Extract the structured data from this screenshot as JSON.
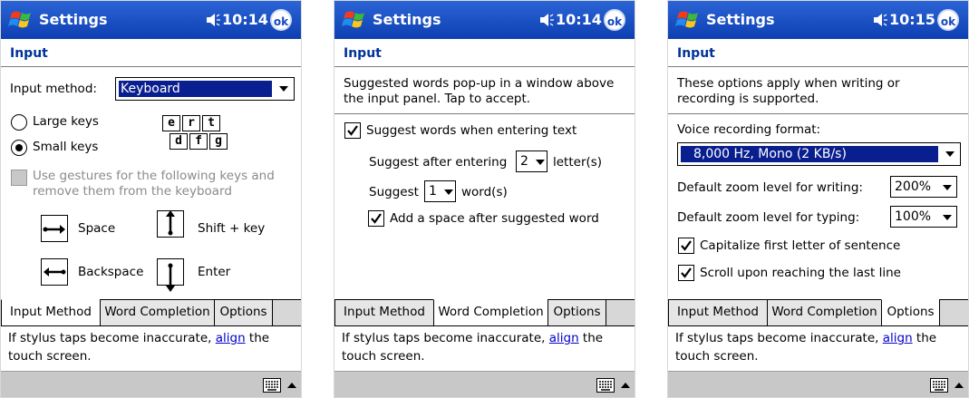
{
  "colors": {
    "titlebar": "#0d3fb2",
    "heading": "#003399",
    "selection": "#0a1f8f",
    "link": "#0000cc",
    "menubar": "#c8c8c8"
  },
  "icons": {
    "start": "windows-flag-icon",
    "volume": "speaker-icon",
    "ok": "ok-button-icon",
    "keyboard": "keyboard-icon",
    "sip": "triangle-up-icon"
  },
  "screens": [
    {
      "title": "Settings",
      "time": "10:14",
      "ok": "ok",
      "heading": "Input",
      "input_method_label": "Input method:",
      "input_method_value": "Keyboard",
      "radio_large": "Large keys",
      "radio_small": "Small keys",
      "keys_top": [
        "e",
        "r",
        "t"
      ],
      "keys_bottom": [
        "d",
        "f",
        "g"
      ],
      "gestures_checkbox": "Use gestures for the following keys and remove them from the keyboard",
      "gesture_space": "Space",
      "gesture_shift": "Shift + key",
      "gesture_backspace": "Backspace",
      "gesture_enter": "Enter",
      "tabs": [
        "Input Method",
        "Word Completion",
        "Options"
      ],
      "active_tab": 0,
      "footer_before": "If stylus taps become inaccurate, ",
      "footer_link": "align",
      "footer_after": " the touch screen."
    },
    {
      "title": "Settings",
      "time": "10:14",
      "ok": "ok",
      "heading": "Input",
      "description": "Suggested words pop-up in a window above the input panel. Tap to accept.",
      "suggest_checkbox": "Suggest words when entering text",
      "suggest_after_label": "Suggest after entering",
      "suggest_after_value": "2",
      "letters_label": "letter(s)",
      "suggest_label": "Suggest",
      "suggest_count_value": "1",
      "words_label": "word(s)",
      "add_space_checkbox": "Add a space after suggested word",
      "tabs": [
        "Input Method",
        "Word Completion",
        "Options"
      ],
      "active_tab": 1,
      "footer_before": "If stylus taps become inaccurate, ",
      "footer_link": "align",
      "footer_after": " the touch screen."
    },
    {
      "title": "Settings",
      "time": "10:15",
      "ok": "ok",
      "heading": "Input",
      "description": "These options apply when writing or recording is supported.",
      "voice_format_label": "Voice recording format:",
      "voice_format_value": "8,000 Hz, Mono (2 KB/s)",
      "zoom_writing_label": "Default zoom level for writing:",
      "zoom_writing_value": "200%",
      "zoom_typing_label": "Default zoom level for typing:",
      "zoom_typing_value": "100%",
      "capitalize_checkbox": "Capitalize first letter of sentence",
      "scroll_checkbox": "Scroll upon reaching the last line",
      "tabs": [
        "Input Method",
        "Word Completion",
        "Options"
      ],
      "active_tab": 2,
      "footer_before": "If stylus taps become inaccurate, ",
      "footer_link": "align",
      "footer_after": " the touch screen."
    }
  ]
}
